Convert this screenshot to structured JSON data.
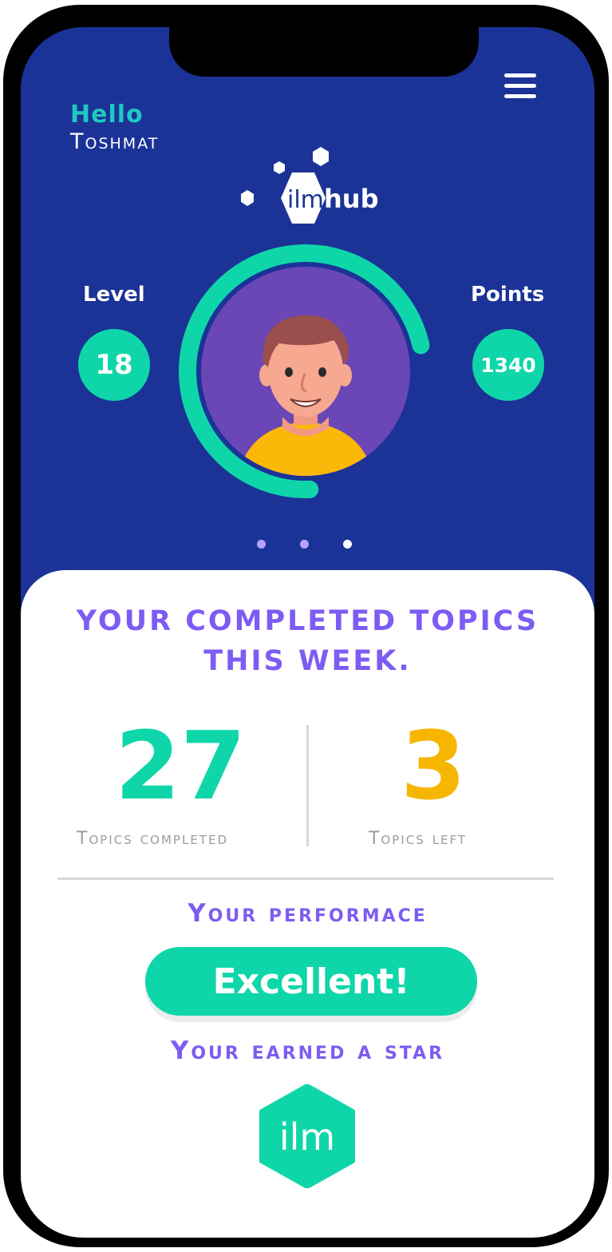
{
  "header": {
    "greeting": "Hello",
    "user_name": "Toshmat"
  },
  "logo": {
    "part1": "ilm",
    "part2": "hub"
  },
  "stats": {
    "level_label": "Level",
    "level_value": "18",
    "points_label": "Points",
    "points_value": "1340",
    "progress_fraction": 0.72
  },
  "colors": {
    "primary": "#1b3397",
    "accent": "#0fd6a9",
    "purple": "#7d5cf2",
    "yellow": "#f6b600"
  },
  "card": {
    "title_line1": "YOUR COMPLETED TOPICS",
    "title_line2": "THIS WEEK.",
    "completed_value": "27",
    "completed_label": "Topics completed",
    "left_value": "3",
    "left_label": "Topics left",
    "performance_heading": "Your performace",
    "performance_value": "Excellent!",
    "star_heading": "Your earned a star",
    "star_text": "ilm"
  }
}
